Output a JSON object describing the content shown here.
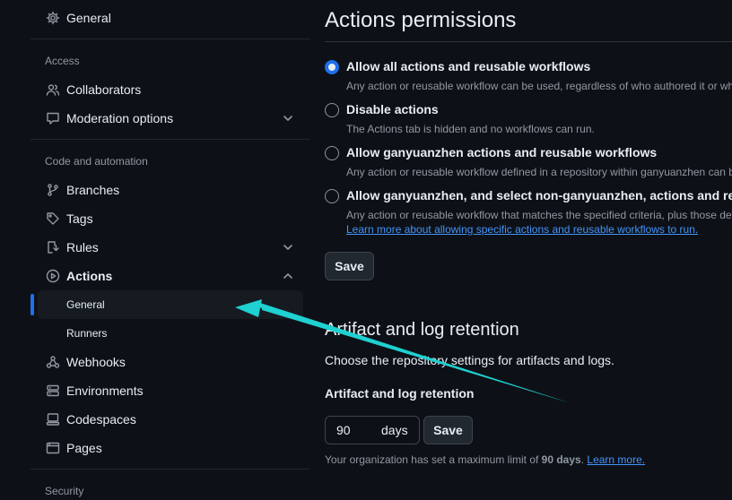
{
  "sidebar": {
    "general_top": "General",
    "access_label": "Access",
    "collaborators": "Collaborators",
    "moderation": "Moderation options",
    "code_label": "Code and automation",
    "branches": "Branches",
    "tags": "Tags",
    "rules": "Rules",
    "actions": "Actions",
    "actions_general": "General",
    "actions_runners": "Runners",
    "webhooks": "Webhooks",
    "environments": "Environments",
    "codespaces": "Codespaces",
    "pages": "Pages",
    "security_label": "Security"
  },
  "main": {
    "title": "Actions permissions",
    "options": [
      {
        "label": "Allow all actions and reusable workflows",
        "desc": "Any action or reusable workflow can be used, regardless of who authored it or wh",
        "checked": true
      },
      {
        "label": "Disable actions",
        "desc": "The Actions tab is hidden and no workflows can run.",
        "checked": false
      },
      {
        "label": "Allow ganyuanzhen actions and reusable workflows",
        "desc": "Any action or reusable workflow defined in a repository within ganyuanzhen can b",
        "checked": false
      },
      {
        "label": "Allow ganyuanzhen, and select non-ganyuanzhen, actions and reusa",
        "desc": "Any action or reusable workflow that matches the specified criteria, plus those def",
        "link": "Learn more about allowing specific actions and reusable workflows to run.",
        "checked": false
      }
    ],
    "save_label": "Save",
    "retention_title": "Artifact and log retention",
    "retention_desc": "Choose the repository settings for artifacts and logs.",
    "retention_field_label": "Artifact and log retention",
    "retention_value": "90",
    "retention_unit": "days",
    "retention_save": "Save",
    "org_note_prefix": "Your organization has set a maximum limit of ",
    "org_note_bold": "90 days",
    "org_note_sep": ". ",
    "org_note_link": "Learn more."
  },
  "colors": {
    "accent": "#1f6feb",
    "link": "#4493f8",
    "annotation_arrow": "#1fd1d1"
  }
}
